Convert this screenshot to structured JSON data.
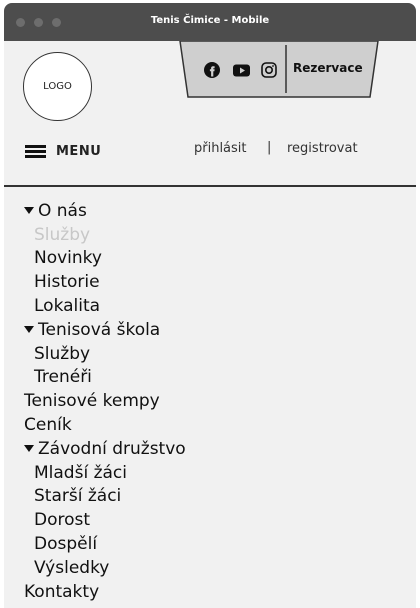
{
  "window": {
    "title": "Tenis Čimice - Mobile"
  },
  "header": {
    "logo_text": "LOGO",
    "reservation_label": "Rezervace",
    "social_icons": [
      "facebook-icon",
      "youtube-icon",
      "instagram-icon"
    ]
  },
  "menu": {
    "label": "MENU"
  },
  "auth": {
    "login": "přihlásit",
    "separator": "|",
    "register": "registrovat"
  },
  "nav": {
    "items": [
      {
        "label": "O nás",
        "level": 0,
        "expanded": true
      },
      {
        "label": "Služby",
        "level": 1,
        "muted": true
      },
      {
        "label": "Novinky",
        "level": 1
      },
      {
        "label": "Historie",
        "level": 1
      },
      {
        "label": "Lokalita",
        "level": 1
      },
      {
        "label": "Tenisová škola",
        "level": 0,
        "expanded": true
      },
      {
        "label": "Služby",
        "level": 1
      },
      {
        "label": "Trenéři",
        "level": 1
      },
      {
        "label": "Tenisové kempy",
        "level": 0
      },
      {
        "label": "Ceník",
        "level": 0
      },
      {
        "label": "Závodní družstvo",
        "level": 0,
        "expanded": true
      },
      {
        "label": "Mladší žáci",
        "level": 1
      },
      {
        "label": "Starší žáci",
        "level": 1
      },
      {
        "label": "Dorost",
        "level": 1
      },
      {
        "label": "Dospělí",
        "level": 1
      },
      {
        "label": "Výsledky",
        "level": 1
      },
      {
        "label": "Kontakty",
        "level": 0
      }
    ]
  }
}
